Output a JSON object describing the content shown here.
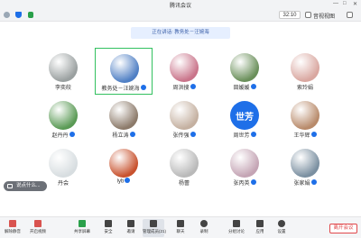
{
  "window": {
    "title": "腾讯会议"
  },
  "toolbar": {
    "timer": "32:10"
  },
  "speaking": {
    "label": "正在讲话: 教务处－汪婉海"
  },
  "participants": [
    {
      "name": "李奕皎",
      "mic": false,
      "active": false,
      "type": "photo",
      "color": "#9aa0a0"
    },
    {
      "name": "教务处－汪婉海",
      "mic": true,
      "active": true,
      "type": "photo",
      "color": "#4f7fc4"
    },
    {
      "name": "周洪搜",
      "mic": true,
      "active": false,
      "type": "photo",
      "color": "#c9748a"
    },
    {
      "name": "田媛媛",
      "mic": true,
      "active": false,
      "type": "photo",
      "color": "#6a8f5a"
    },
    {
      "name": "索玲娟",
      "mic": false,
      "active": false,
      "type": "photo",
      "color": "#d9a7a0"
    },
    {
      "name": "赵丹丹",
      "mic": true,
      "active": false,
      "type": "photo",
      "color": "#5a9a55"
    },
    {
      "name": "杨立涛",
      "mic": true,
      "active": false,
      "type": "photo",
      "color": "#8c7a6a"
    },
    {
      "name": "张传强",
      "mic": true,
      "active": false,
      "type": "photo",
      "color": "#c4b0a0"
    },
    {
      "name": "周世芳",
      "mic": true,
      "active": false,
      "type": "text",
      "avatar_text": "世芳",
      "color": "#1e6fe8"
    },
    {
      "name": "王华辉",
      "mic": true,
      "active": false,
      "type": "photo",
      "color": "#b88a6a"
    },
    {
      "name": "丹会",
      "mic": false,
      "active": false,
      "type": "photo",
      "color": "#d7dde0"
    },
    {
      "name": "lyb",
      "mic": true,
      "active": false,
      "type": "photo",
      "color": "#c8522e"
    },
    {
      "name": "杨蕾",
      "mic": false,
      "active": false,
      "type": "photo",
      "color": "#b9b9b9"
    },
    {
      "name": "张丙英",
      "mic": true,
      "active": false,
      "type": "photo",
      "color": "#c4a4b4"
    },
    {
      "name": "张家娟",
      "mic": true,
      "active": false,
      "type": "photo",
      "color": "#7a8fa0"
    }
  ],
  "chat": {
    "placeholder": "说点什么..."
  },
  "bottombar": {
    "items": [
      {
        "label": "解除静音",
        "icon": "microphone-icon",
        "color": "#d9534f"
      },
      {
        "label": "开启视频",
        "icon": "camera-icon",
        "color": "#d9534f"
      },
      {
        "label": "共享屏幕",
        "icon": "share-screen-icon",
        "color": "#2aa04a"
      },
      {
        "label": "安全",
        "icon": "shield-icon",
        "color": "#444"
      },
      {
        "label": "邀请",
        "icon": "invite-icon",
        "color": "#444"
      },
      {
        "label": "管理成员(21)",
        "icon": "members-icon",
        "color": "#444"
      },
      {
        "label": "聊天",
        "icon": "chat-icon",
        "color": "#444"
      },
      {
        "label": "录制",
        "icon": "record-icon",
        "color": "#444"
      },
      {
        "label": "分组讨论",
        "icon": "breakout-icon",
        "color": "#444"
      },
      {
        "label": "应用",
        "icon": "apps-icon",
        "color": "#444"
      },
      {
        "label": "设置",
        "icon": "gear-icon",
        "color": "#444"
      }
    ],
    "leave_label": "离开会议"
  }
}
